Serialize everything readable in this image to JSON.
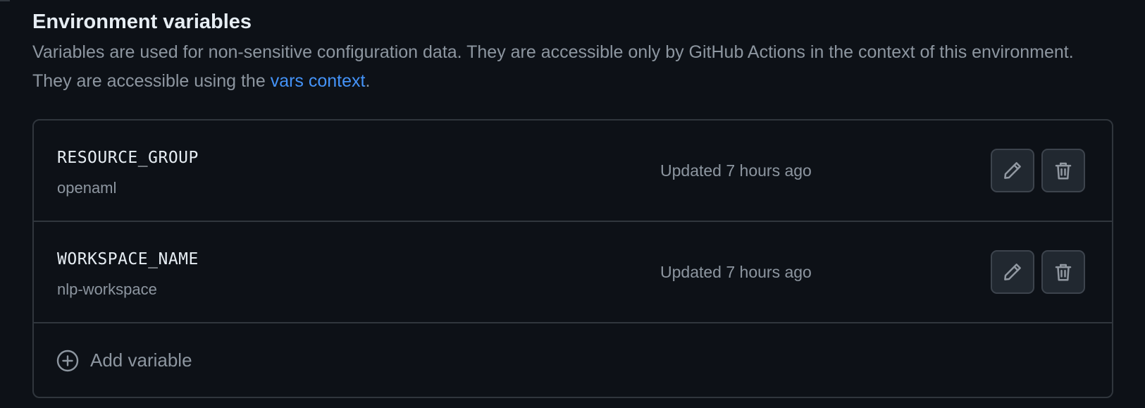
{
  "section": {
    "title": "Environment variables",
    "description_prefix": "Variables are used for non-sensitive configuration data. They are accessible only by GitHub Actions in the context of this environment. They are accessible using the ",
    "description_link": "vars context",
    "description_suffix": "."
  },
  "variables": [
    {
      "name": "RESOURCE_GROUP",
      "value": "openaml",
      "updated": "Updated 7 hours ago",
      "edit_icon": "pencil-icon",
      "delete_icon": "trash-icon"
    },
    {
      "name": "WORKSPACE_NAME",
      "value": "nlp-workspace",
      "updated": "Updated 7 hours ago",
      "edit_icon": "pencil-icon",
      "delete_icon": "trash-icon"
    }
  ],
  "add": {
    "label": "Add variable",
    "icon": "plus-circle-icon"
  },
  "colors": {
    "background": "#0d1117",
    "border": "#30363d",
    "text_primary": "#e6edf3",
    "text_muted": "#8d96a0",
    "link": "#4493f8",
    "button_bg": "#212830"
  }
}
